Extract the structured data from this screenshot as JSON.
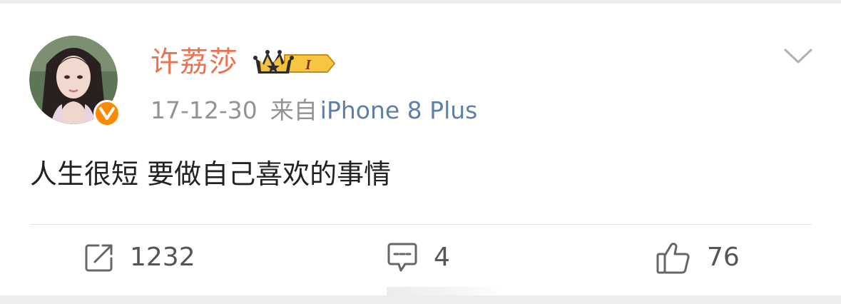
{
  "post": {
    "author": {
      "name": "许荔莎",
      "vip_level": "I",
      "verified": true
    },
    "date": "17-12-30",
    "source_label": "来自",
    "source_device": "iPhone 8 Plus",
    "text": "人生很短 要做自己喜欢的事情",
    "actions": {
      "repost_count": "1232",
      "comment_count": "4",
      "like_count": "76"
    }
  },
  "colors": {
    "username": "#eb7350",
    "meta": "#939393",
    "device_link": "#5d7fa8",
    "verified_badge": "#ff8a00",
    "vip_gold": "#f2b632"
  },
  "icons": {
    "more": "chevron-down-icon",
    "verified": "verified-v-icon",
    "vip": "crown-icon",
    "repost": "repost-icon",
    "comment": "comment-icon",
    "like": "thumbs-up-icon"
  }
}
